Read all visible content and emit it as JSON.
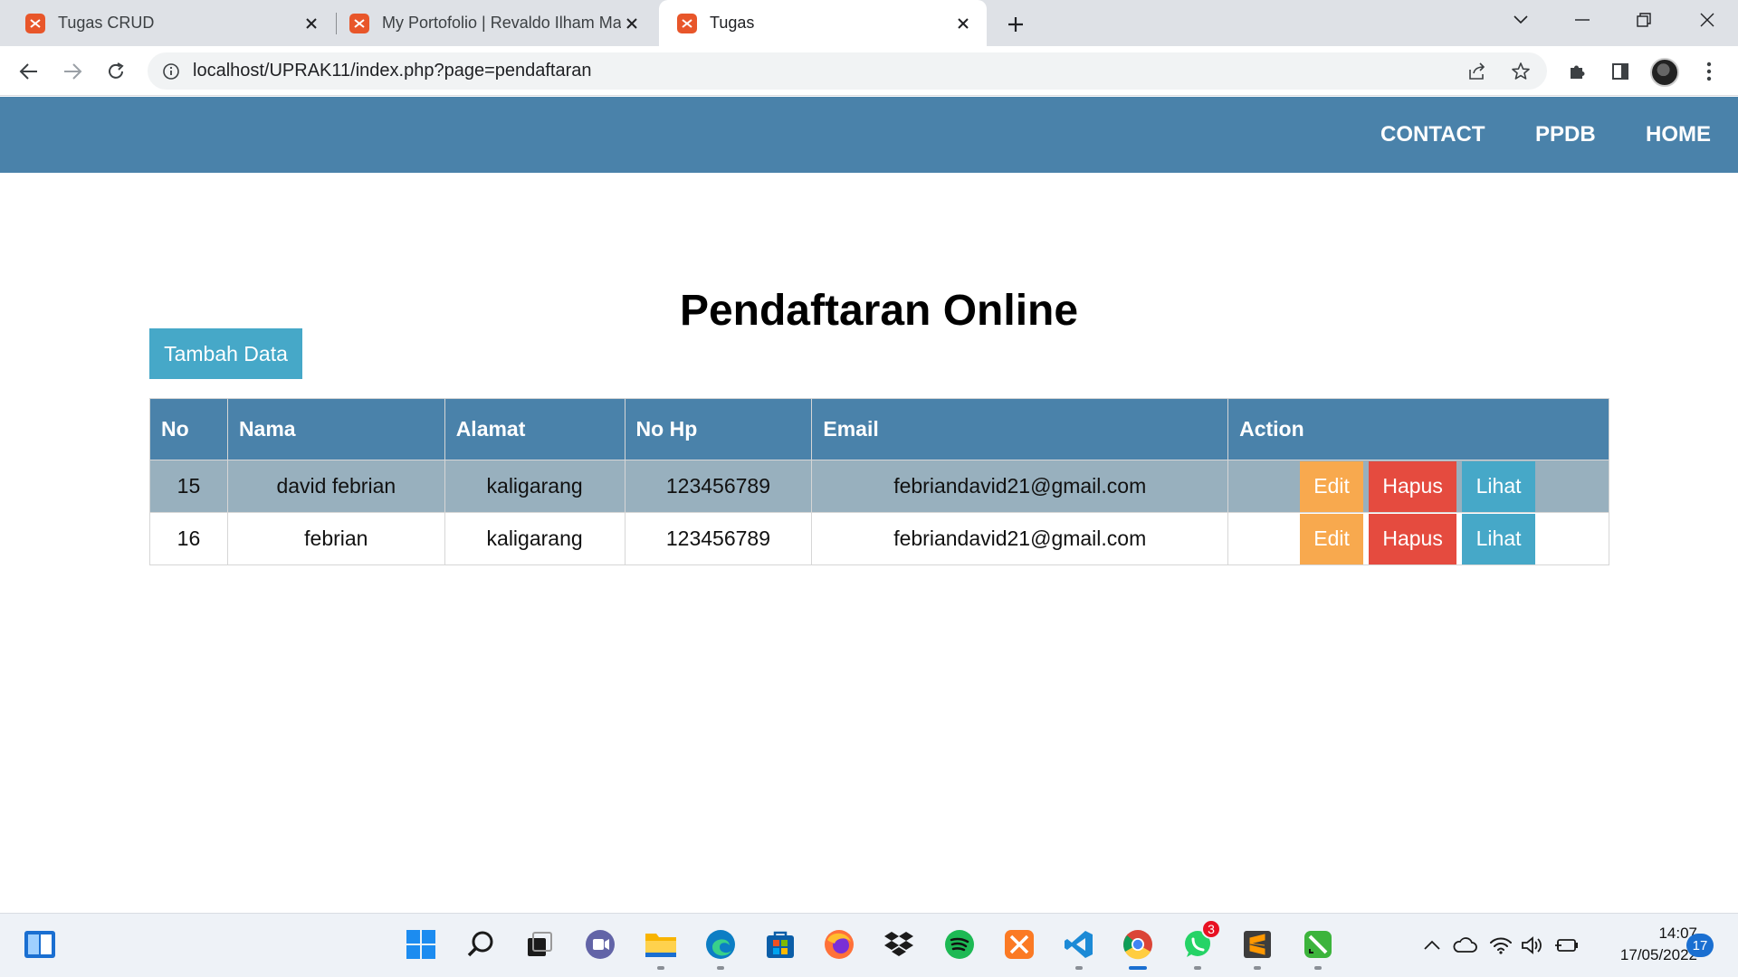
{
  "browser": {
    "tabs": [
      {
        "title": "Tugas CRUD",
        "active": false
      },
      {
        "title": "My Portofolio | Revaldo Ilham Ma",
        "active": false
      },
      {
        "title": "Tugas",
        "active": true
      }
    ],
    "url": "localhost/UPRAK11/index.php?page=pendaftaran"
  },
  "nav": {
    "links": [
      "CONTACT",
      "PPDB",
      "HOME"
    ]
  },
  "main": {
    "title": "Pendaftaran Online",
    "add_button": "Tambah Data",
    "table": {
      "headers": [
        "No",
        "Nama",
        "Alamat",
        "No Hp",
        "Email",
        "Action"
      ],
      "rows": [
        {
          "no": "15",
          "nama": "david febrian",
          "alamat": "kaligarang",
          "nohp": "123456789",
          "email": "febriandavid21@gmail.com"
        },
        {
          "no": "16",
          "nama": "febrian",
          "alamat": "kaligarang",
          "nohp": "123456789",
          "email": "febriandavid21@gmail.com"
        }
      ],
      "actions": {
        "edit": "Edit",
        "hapus": "Hapus",
        "lihat": "Lihat"
      }
    }
  },
  "taskbar": {
    "whatsapp_badge": "3",
    "time": "14:07",
    "date": "17/05/2022",
    "notification_count": "17"
  },
  "colors": {
    "navbar": "#4a82aa",
    "row_highlight": "#98b0be",
    "edit": "#f8a94e",
    "hapus": "#e54b3f",
    "lihat": "#46a8c8"
  }
}
